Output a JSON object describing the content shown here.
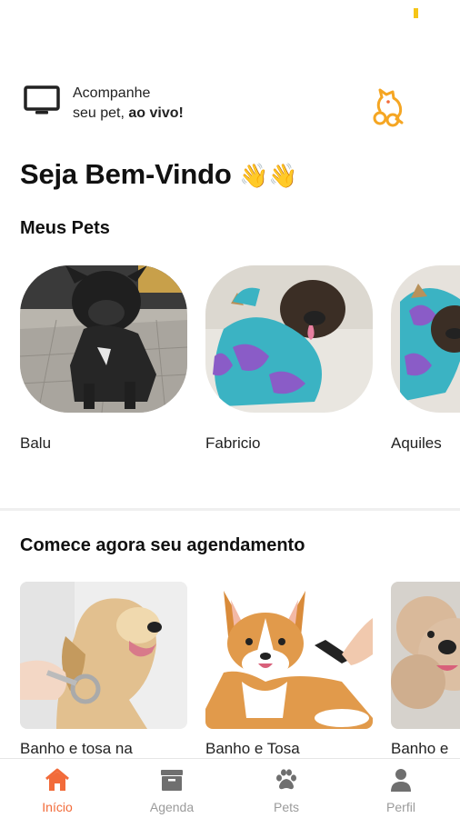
{
  "header": {
    "live_line1": "Acompanhe",
    "live_line2_prefix": "seu pet, ",
    "live_line2_bold": "ao vivo!"
  },
  "welcome": {
    "title": "Seja Bem-Vindo",
    "emoji": "👋👋"
  },
  "pets": {
    "title": "Meus Pets",
    "items": [
      {
        "name": "Balu"
      },
      {
        "name": "Fabricio"
      },
      {
        "name": "Aquiles"
      }
    ]
  },
  "schedule": {
    "title": "Comece agora seu agendamento",
    "items": [
      {
        "name": "Banho e tosa na"
      },
      {
        "name": "Banho e Tosa"
      },
      {
        "name": "Banho e"
      }
    ]
  },
  "nav": {
    "items": [
      {
        "label": "Início",
        "icon": "home-icon",
        "active": true
      },
      {
        "label": "Agenda",
        "icon": "calendar-icon",
        "active": false
      },
      {
        "label": "Pets",
        "icon": "paw-icon",
        "active": false
      },
      {
        "label": "Perfil",
        "icon": "user-icon",
        "active": false
      }
    ]
  },
  "colors": {
    "accent": "#f26b3a",
    "logo": "#f5a623",
    "inactive": "#9b9b9b"
  }
}
